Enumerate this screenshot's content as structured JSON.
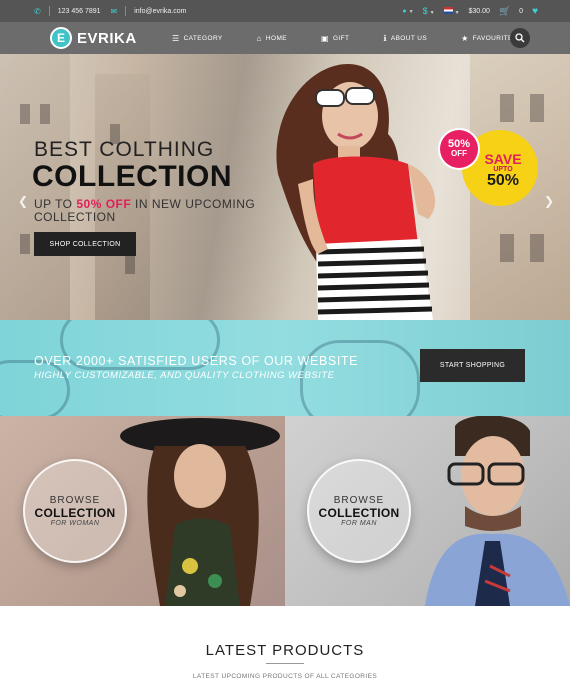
{
  "topbar": {
    "phone": "123 456 7891",
    "email": "info@evrika.com",
    "currency_symbol": "$",
    "cart_total": "$30.00",
    "cart_count": "0"
  },
  "nav": {
    "logo_letter": "E",
    "logo_text": "EVRIKA",
    "items": [
      {
        "label": "CATEGORY",
        "icon": "menu-icon"
      },
      {
        "label": "HOME",
        "icon": "home-icon"
      },
      {
        "label": "GIFT",
        "icon": "gift-icon"
      },
      {
        "label": "ABOUT US",
        "icon": "info-icon"
      },
      {
        "label": "FAVOURITES",
        "icon": "star-icon"
      }
    ]
  },
  "hero": {
    "title_line1": "BEST COLTHING",
    "title_line2": "COLLECTION",
    "sub_prefix": "UP TO ",
    "sub_pct": "50% OFF",
    "sub_suffix": " IN NEW UPCOMING COLLECTION",
    "button": "SHOP COLLECTION",
    "badge_off_pct": "50%",
    "badge_off_word": "OFF",
    "badge_save_1": "SAVE",
    "badge_save_2": "UPTO",
    "badge_save_3": "50%"
  },
  "banner": {
    "line1": "OVER 2000+ SATISFIED USERS OF OUR WEBSITE",
    "line2": "HIGHLY CUSTOMIZABLE, AND QUALITY CLOTHING WEBSITE",
    "button": "START SHOPPING"
  },
  "collections": [
    {
      "browse": "BROWSE",
      "title": "COLLECTION",
      "for": "FOR WOMAN"
    },
    {
      "browse": "BROWSE",
      "title": "COLLECTION",
      "for": "FOR MAN"
    }
  ],
  "latest": {
    "title": "LATEST PRODUCTS",
    "subtitle": "LATEST UPCOMING PRODUCTS OF ALL CATEGORIES"
  },
  "colors": {
    "accent_teal": "#3fd0d4",
    "accent_pink": "#e0205b",
    "badge_yellow": "#f7d116"
  }
}
